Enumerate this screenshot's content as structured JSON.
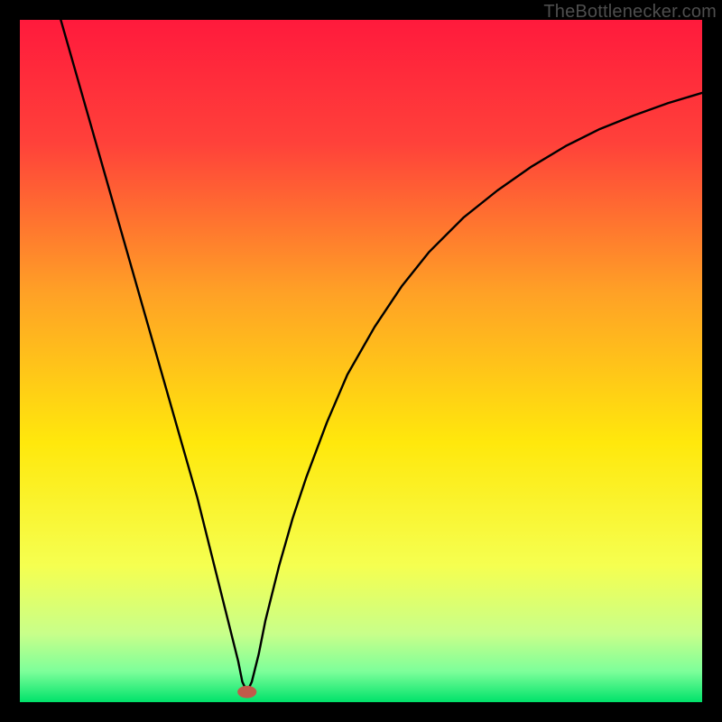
{
  "attribution": "TheBottlenecker.com",
  "chart_data": {
    "type": "line",
    "title": "",
    "xlabel": "",
    "ylabel": "",
    "xlim": [
      0,
      100
    ],
    "ylim": [
      0,
      100
    ],
    "gradient_stops": [
      {
        "offset": 0.0,
        "color": "#ff1a3c"
      },
      {
        "offset": 0.18,
        "color": "#ff413a"
      },
      {
        "offset": 0.4,
        "color": "#ffa126"
      },
      {
        "offset": 0.62,
        "color": "#ffe80c"
      },
      {
        "offset": 0.8,
        "color": "#f5ff50"
      },
      {
        "offset": 0.9,
        "color": "#c8ff8a"
      },
      {
        "offset": 0.955,
        "color": "#7dff9a"
      },
      {
        "offset": 1.0,
        "color": "#00e26a"
      }
    ],
    "marker": {
      "x": 33.3,
      "y": 1.5,
      "color": "#c15a4a",
      "rx": 1.4,
      "ry": 0.9
    },
    "series": [
      {
        "name": "bottleneck-curve",
        "x": [
          6,
          8,
          10,
          12,
          14,
          16,
          18,
          20,
          22,
          24,
          26,
          28,
          30,
          31,
          32,
          32.6,
          33.3,
          34,
          35,
          36,
          38,
          40,
          42,
          45,
          48,
          52,
          56,
          60,
          65,
          70,
          75,
          80,
          85,
          90,
          95,
          100
        ],
        "values": [
          100,
          93,
          86,
          79,
          72,
          65,
          58,
          51,
          44,
          37,
          30,
          22,
          14,
          10,
          6,
          3,
          1.5,
          3,
          7,
          12,
          20,
          27,
          33,
          41,
          48,
          55,
          61,
          66,
          71,
          75,
          78.5,
          81.5,
          84,
          86,
          87.8,
          89.3
        ]
      }
    ]
  }
}
